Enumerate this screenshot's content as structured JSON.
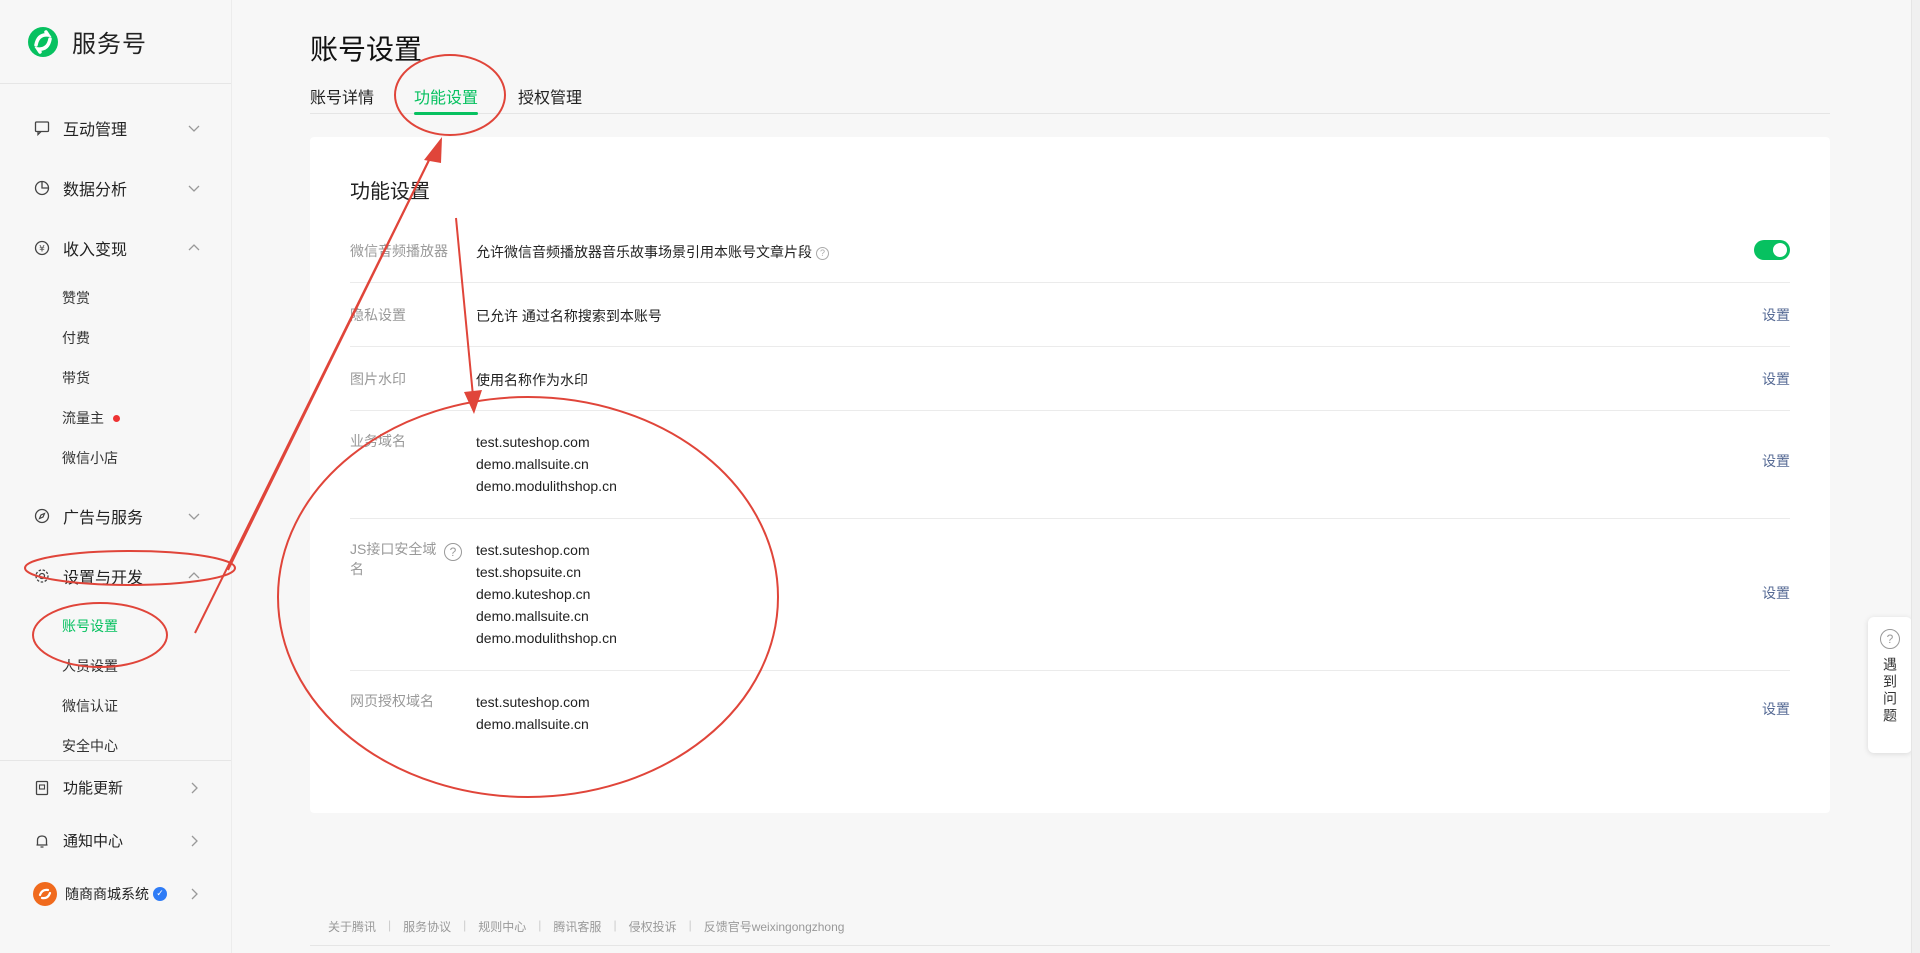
{
  "brand": {
    "name": "服务号"
  },
  "sidebar": {
    "groups": [
      {
        "label": "互动管理",
        "icon": "chat-icon"
      },
      {
        "label": "数据分析",
        "icon": "pie-chart-icon"
      },
      {
        "label": "收入变现",
        "icon": "yuan-coin-icon"
      }
    ],
    "monetize_items": [
      {
        "label": "赞赏"
      },
      {
        "label": "付费"
      },
      {
        "label": "带货"
      },
      {
        "label": "流量主"
      },
      {
        "label": "微信小店"
      }
    ],
    "ads_group": {
      "label": "广告与服务",
      "icon": "compass-icon"
    },
    "dev_group": {
      "label": "设置与开发",
      "icon": "gear-icon"
    },
    "dev_items": [
      {
        "label": "账号设置"
      },
      {
        "label": "人员设置"
      },
      {
        "label": "微信认证"
      },
      {
        "label": "安全中心"
      }
    ],
    "bottom": [
      {
        "label": "功能更新",
        "icon": "update-doc-icon"
      },
      {
        "label": "通知中心",
        "icon": "bell-icon"
      },
      {
        "label": "随商商城系统",
        "icon": "account-avatar"
      }
    ]
  },
  "page": {
    "title": "账号设置",
    "tabs": [
      {
        "label": "账号详情"
      },
      {
        "label": "功能设置"
      },
      {
        "label": "授权管理"
      }
    ]
  },
  "card": {
    "title": "功能设置",
    "rows": [
      {
        "label": "微信音频播放器",
        "content": "允许微信音频播放器音乐故事场景引用本账号文章片段",
        "toggle_on": true
      },
      {
        "label": "隐私设置",
        "content": "已允许 通过名称搜索到本账号",
        "action": "设置"
      },
      {
        "label": "图片水印",
        "content": "使用名称作为水印",
        "action": "设置"
      },
      {
        "label": "业务域名",
        "lines": [
          "test.suteshop.com",
          "demo.mallsuite.cn",
          "demo.modulithshop.cn"
        ],
        "action": "设置"
      },
      {
        "label": "JS接口安全域名",
        "lines": [
          "test.suteshop.com",
          "test.shopsuite.cn",
          "demo.kuteshop.cn",
          "demo.mallsuite.cn",
          "demo.modulithshop.cn"
        ],
        "action": "设置"
      },
      {
        "label": "网页授权域名",
        "lines": [
          "test.suteshop.com",
          "demo.mallsuite.cn"
        ],
        "action": "设置"
      }
    ]
  },
  "footer": {
    "links": [
      "关于腾讯",
      "服务协议",
      "规则中心",
      "腾讯客服",
      "侵权投诉",
      "反馈官号weixingongzhong"
    ]
  },
  "help": {
    "label": "遇到问题"
  },
  "colors": {
    "accent": "#07c160",
    "link": "#576b95",
    "annotation": "#e0453a"
  }
}
